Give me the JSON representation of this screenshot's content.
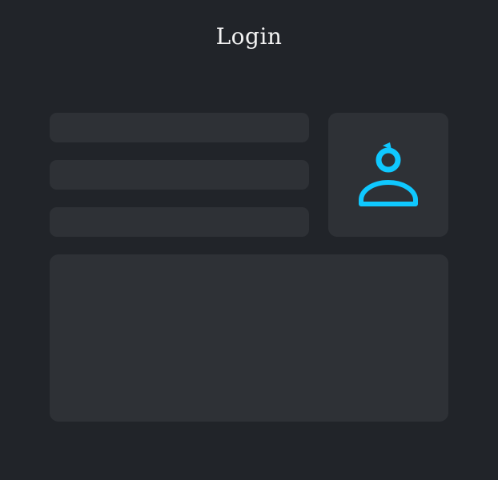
{
  "header": {
    "title": "Login"
  },
  "form": {
    "fields": [
      {
        "value": "",
        "placeholder": ""
      },
      {
        "value": "",
        "placeholder": ""
      },
      {
        "value": "",
        "placeholder": ""
      }
    ]
  },
  "avatar": {
    "icon": "user-icon",
    "accent_color": "#0fc8ff"
  },
  "theme": {
    "background": "#212429",
    "panel": "#2e3136"
  }
}
